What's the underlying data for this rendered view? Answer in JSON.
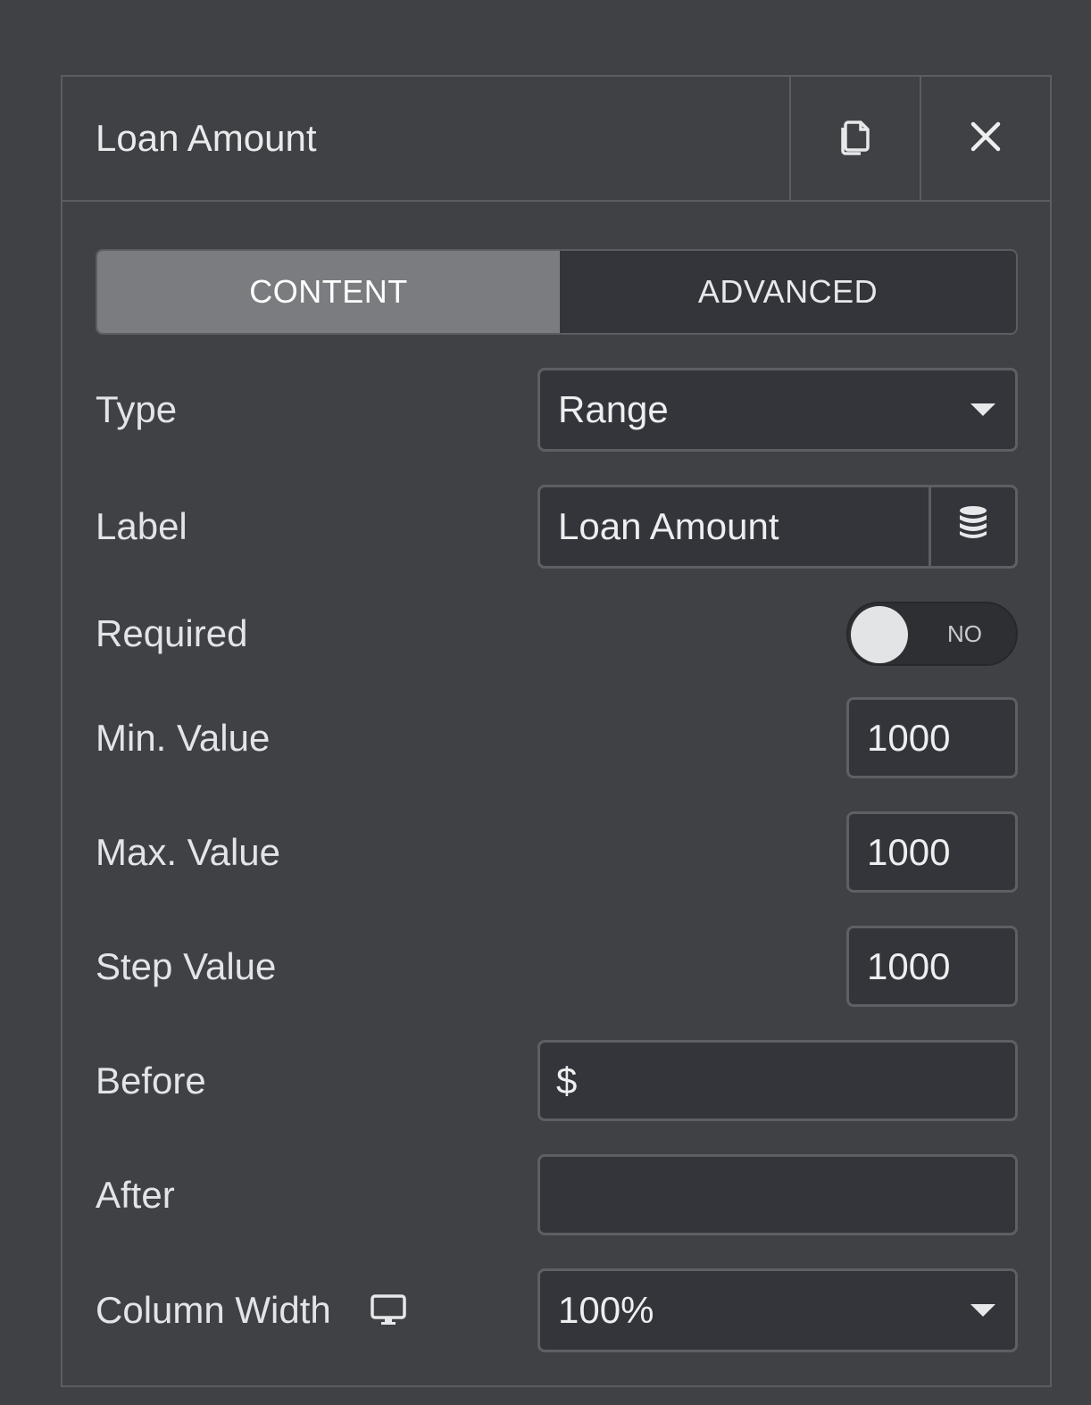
{
  "header": {
    "title": "Loan Amount",
    "duplicate_icon": "duplicate-icon",
    "close_icon": "close-icon"
  },
  "tabs": [
    {
      "label": "CONTENT",
      "active": true
    },
    {
      "label": "ADVANCED",
      "active": false
    }
  ],
  "fields": {
    "type": {
      "label": "Type",
      "value": "Range"
    },
    "label": {
      "label": "Label",
      "value": "Loan Amount",
      "icon": "database-icon"
    },
    "required": {
      "label": "Required",
      "state": "NO"
    },
    "min_value": {
      "label": "Min. Value",
      "value": "1000"
    },
    "max_value": {
      "label": "Max. Value",
      "value": "1000"
    },
    "step_value": {
      "label": "Step Value",
      "value": "1000"
    },
    "before": {
      "label": "Before",
      "value": "$"
    },
    "after": {
      "label": "After",
      "value": ""
    },
    "column_width": {
      "label": "Column Width",
      "value": "100%",
      "icon": "desktop-icon"
    }
  },
  "colors": {
    "background": "#404145",
    "input_bg": "#33353a",
    "active_tab": "#7b7c80",
    "border": "#5b5d62"
  }
}
